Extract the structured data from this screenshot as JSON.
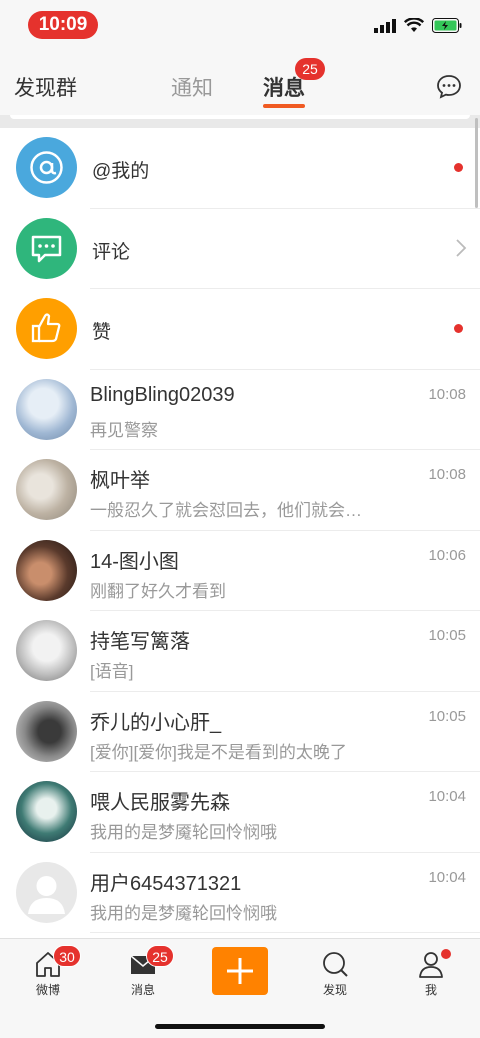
{
  "status_bar": {
    "time": "10:09"
  },
  "top_nav": {
    "left_label": "发现群",
    "tabs": [
      {
        "label": "通知",
        "active": false
      },
      {
        "label": "消息",
        "active": true
      }
    ],
    "message_badge": "25"
  },
  "system_rows": [
    {
      "label": "@我的",
      "indicator": "dot",
      "icon": "at-icon",
      "color": "#4aa8dd"
    },
    {
      "label": "评论",
      "indicator": "chevron",
      "icon": "comment-icon",
      "color": "#2fb67c"
    },
    {
      "label": "赞",
      "indicator": "dot",
      "icon": "thumbs-up-icon",
      "color": "#ff9f00"
    }
  ],
  "conversations": [
    {
      "name": "BlingBling02039",
      "preview": "再见警察",
      "time": "10:08"
    },
    {
      "name": "枫叶举",
      "preview": "一般忍久了就会怼回去，他们就会…",
      "time": "10:08"
    },
    {
      "name": "14-图小图",
      "preview": "刚翻了好久才看到",
      "time": "10:06"
    },
    {
      "name": "持笔写篱落",
      "preview": "[语音]",
      "time": "10:05"
    },
    {
      "name": "乔儿的小心肝_",
      "preview": "[爱你][爱你]我是不是看到的太晚了",
      "time": "10:05"
    },
    {
      "name": "喂人民服雾先森",
      "preview": "我用的是梦魇轮回怜悯哦",
      "time": "10:04"
    },
    {
      "name": "用户6454371321",
      "preview": "我用的是梦魇轮回怜悯哦",
      "time": "10:04"
    }
  ],
  "tab_bar": {
    "items": [
      {
        "label": "微博",
        "badge": "30",
        "icon": "home-icon"
      },
      {
        "label": "消息",
        "badge": "25",
        "icon": "mail-icon"
      },
      {
        "label": "",
        "icon": "plus-icon"
      },
      {
        "label": "发现",
        "icon": "search-icon"
      },
      {
        "label": "我",
        "icon": "profile-icon",
        "dot": true
      }
    ]
  },
  "colors": {
    "accent": "#ff8200",
    "badge": "#e5322d",
    "tab_underline": "#f05a22"
  }
}
